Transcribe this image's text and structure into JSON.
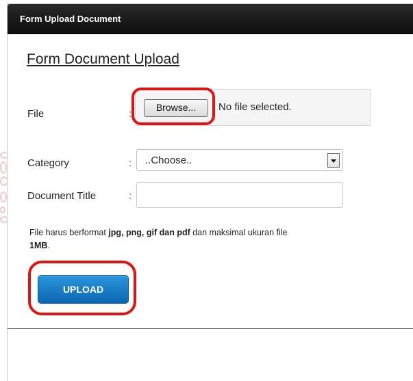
{
  "panel": {
    "title": "Form Upload Document"
  },
  "form": {
    "heading": "Form Document Upload",
    "colon": ":",
    "file": {
      "label": "File",
      "browse_label": "Browse...",
      "status": "No file selected."
    },
    "category": {
      "label": "Category",
      "selected": "..Choose.."
    },
    "document_title": {
      "label": "Document Title",
      "value": ""
    },
    "note": {
      "prefix": "File harus berformat ",
      "formats": "jpg, png, gif dan pdf",
      "middle": " dan maksimal ukuran file ",
      "size": "1MB",
      "suffix": "."
    },
    "upload_label": "UPLOAD"
  },
  "colors": {
    "header_bg": "#111111",
    "upload_button": "#1a7fc8",
    "highlight": "#e01313"
  }
}
